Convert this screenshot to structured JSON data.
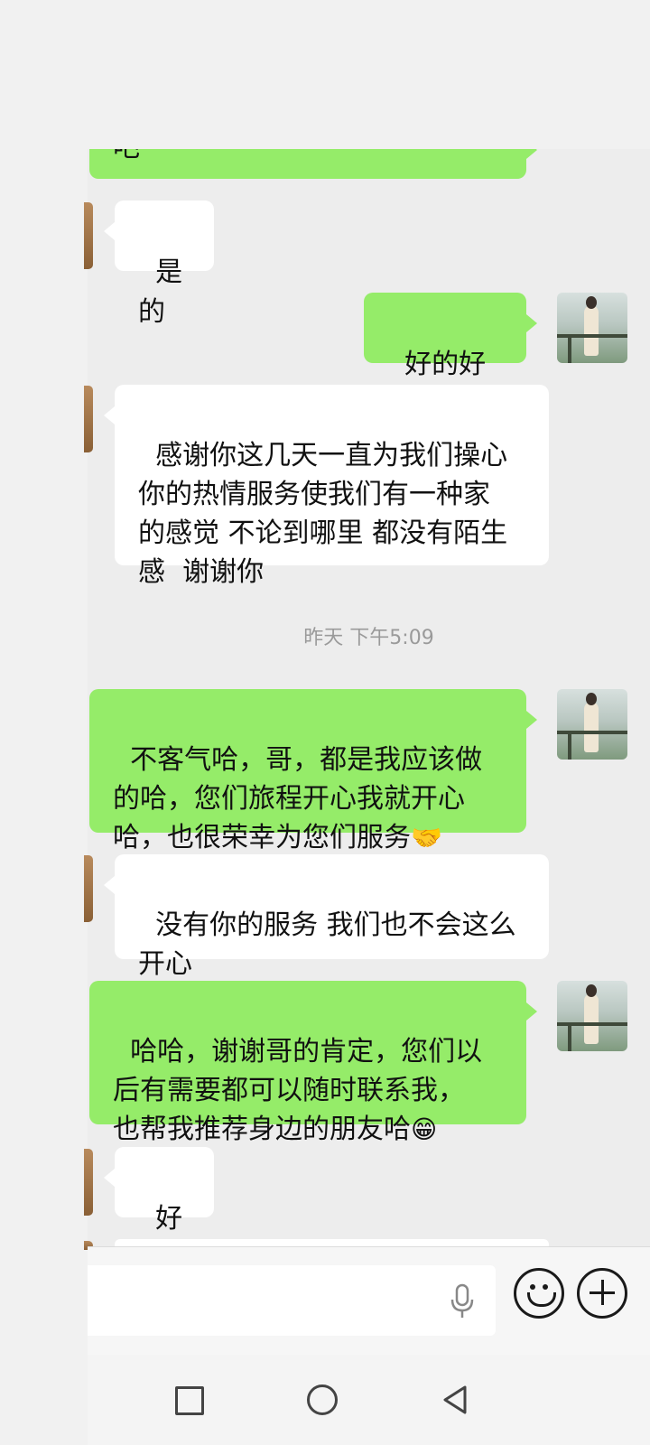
{
  "messages": {
    "m0": {
      "text": "吧"
    },
    "m1": {
      "text": "是的"
    },
    "m2": {
      "text": "好的好的"
    },
    "m3": {
      "text": "感谢你这几天一直为我们操心\n你的热情服务使我们有一种家\n的感觉 不论到哪里 都没有陌生\n感  谢谢你"
    },
    "time": "昨天 下午5:09",
    "m4": {
      "text": "不客气哈，哥，都是我应该做\n的哈，您们旅程开心我就开心\n哈，也很荣幸为您们服务",
      "emoji": "🤝"
    },
    "m5": {
      "text": "没有你的服务 我们也不会这么\n开心"
    },
    "m6": {
      "text": "哈哈，谢谢哥的肯定，您们以\n后有需要都可以随时联系我，\n也帮我推荐身边的朋友哈",
      "emoji": "😁"
    },
    "m7": {
      "text": "好的"
    }
  },
  "input": {
    "placeholder": ""
  },
  "icons": {
    "mic": "microphone-icon",
    "emoji": "smiley-icon",
    "more": "plus-icon",
    "nav_recent": "square-icon",
    "nav_home": "circle-icon",
    "nav_back": "triangle-back-icon"
  },
  "colors": {
    "outgoing_bubble": "#95ec69",
    "incoming_bubble": "#ffffff",
    "chat_background": "#ededed"
  }
}
